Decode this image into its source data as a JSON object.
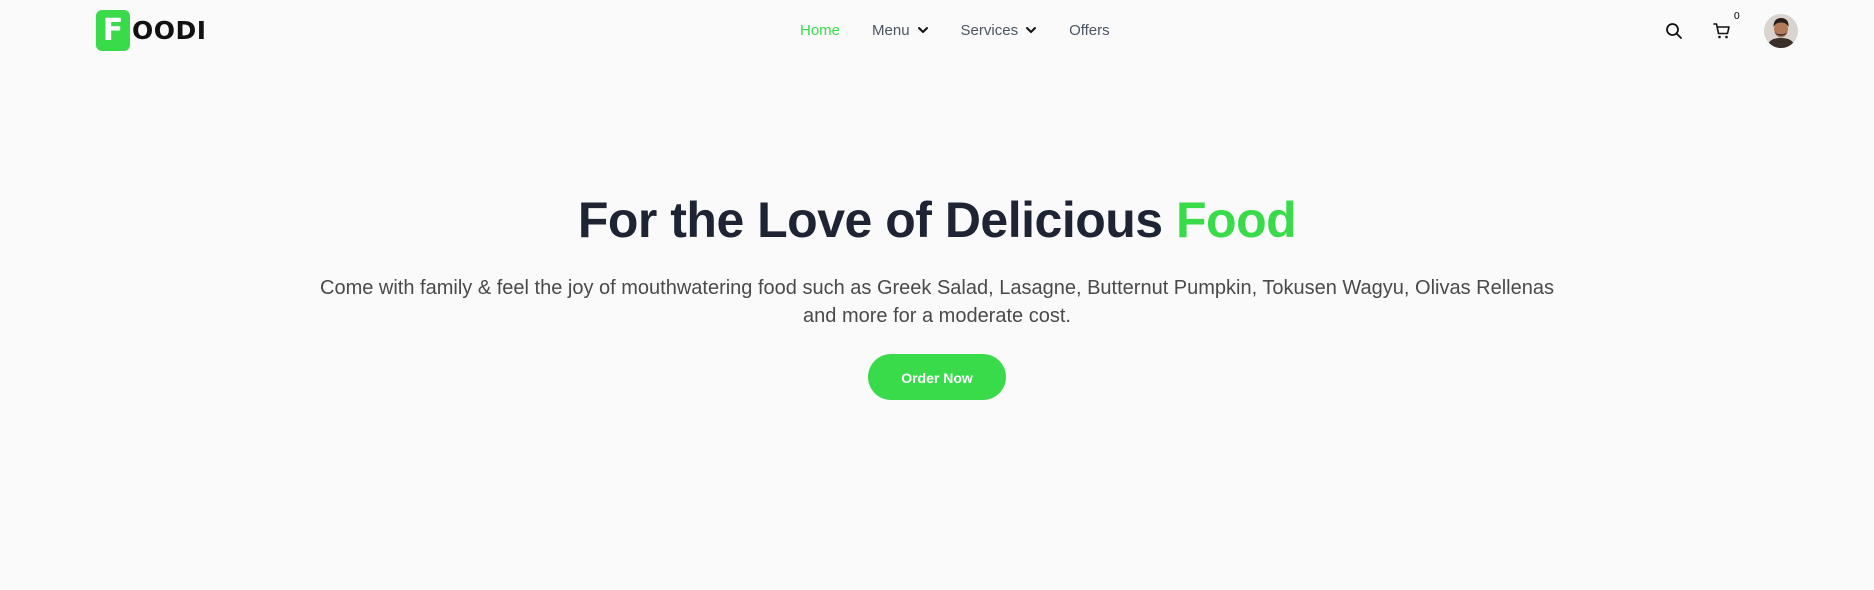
{
  "brand": {
    "logo_letter": "F",
    "logo_rest": "OODI",
    "accent_color": "#39DB4A"
  },
  "nav": {
    "links": [
      {
        "label": "Home",
        "active": true
      },
      {
        "label": "Menu",
        "has_dropdown": true
      },
      {
        "label": "Services",
        "has_dropdown": true
      },
      {
        "label": "Offers"
      }
    ]
  },
  "actions": {
    "search_icon": "search-icon",
    "cart_icon": "cart-icon",
    "cart_count": "0",
    "avatar_icon": "avatar"
  },
  "hero": {
    "title_main": "For the Love of Delicious",
    "title_accent": "Food",
    "description": "Come with family & feel the joy of mouthwatering food such as Greek Salad, Lasagne, Butternut Pumpkin, Tokusen Wagyu, Olivas Rellenas and more for a moderate cost.",
    "cta_label": "Order Now"
  }
}
